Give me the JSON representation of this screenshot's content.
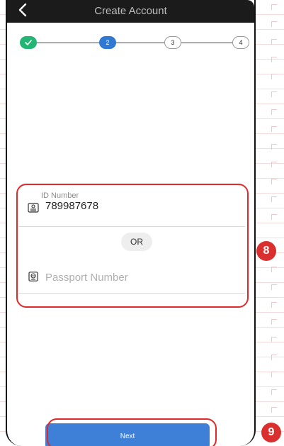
{
  "header": {
    "title": "Create Account"
  },
  "stepper": {
    "steps": [
      "",
      "2",
      "3",
      "4"
    ],
    "current_step": 2,
    "completed_steps": 1
  },
  "form": {
    "id_field": {
      "label": "ID Number",
      "value": "789987678"
    },
    "separator": "OR",
    "passport_field": {
      "placeholder": "Passport Number",
      "value": ""
    }
  },
  "next_button": {
    "label": "Next"
  },
  "annotations": {
    "form_callout": "8",
    "next_callout": "9"
  },
  "colors": {
    "header_bg": "#1b1b1b",
    "step_done": "#22b573",
    "step_active": "#2f78d4",
    "button_primary": "#3e7fd8",
    "annotation_red": "#e02a2a"
  },
  "icons": {
    "back": "chevron-left-icon",
    "step_done": "check-icon",
    "id_field": "id-card-icon",
    "passport_field": "passport-icon"
  }
}
